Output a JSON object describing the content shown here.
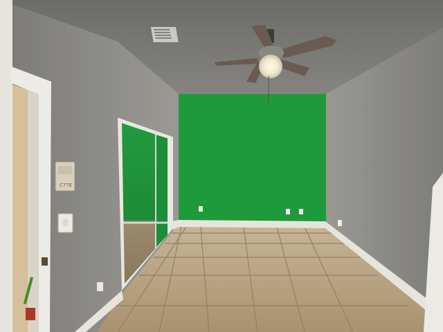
{
  "scene": {
    "thermostat_text": "C77E",
    "colors": {
      "ceiling": "#7c7c79",
      "left_wall": "#8c8b87",
      "right_wall": "#8a8985",
      "accent_wall": "#1e9a3a",
      "floor": "#b9a587",
      "grout": "#8f7c60",
      "baseboard": "#e7e4dc",
      "door_frame": "#ebe8e2",
      "fan_blade": "#6b5a52"
    }
  }
}
